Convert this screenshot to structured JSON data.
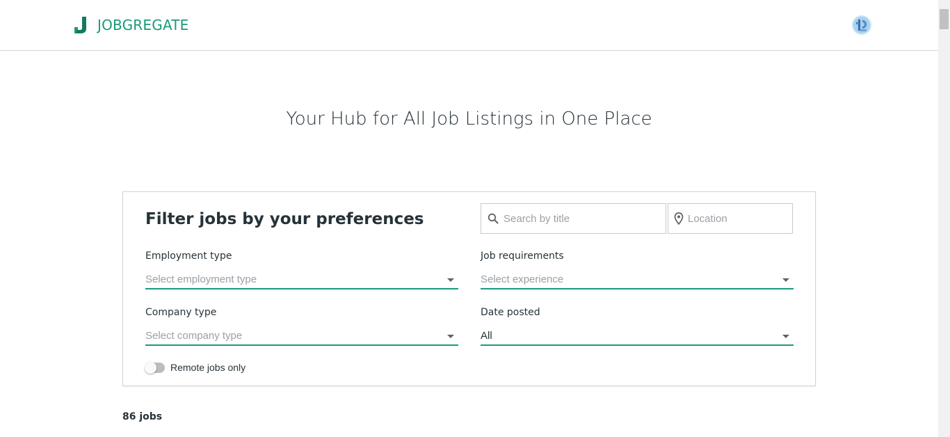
{
  "brand": {
    "name": "JOBGREGATE",
    "logo_icon": "j-logo-icon",
    "color": "#1a9a7a"
  },
  "header": {
    "avatar_icon": "user-avatar"
  },
  "hero": {
    "title": "Your Hub for All Job Listings in One Place"
  },
  "filters": {
    "title": "Filter jobs by your preferences",
    "search": {
      "placeholder": "Search by title",
      "value": "",
      "icon": "search-icon"
    },
    "location": {
      "placeholder": "Location",
      "value": "",
      "icon": "location-pin-icon"
    },
    "employment_type": {
      "label": "Employment type",
      "value": "Select employment type"
    },
    "job_requirements": {
      "label": "Job requirements",
      "value": "Select experience"
    },
    "company_type": {
      "label": "Company type",
      "value": "Select company type"
    },
    "date_posted": {
      "label": "Date posted",
      "value": "All"
    },
    "remote": {
      "label": "Remote jobs only",
      "enabled": false
    }
  },
  "results": {
    "count_text": "86 jobs"
  },
  "colors": {
    "accent": "#1a9a7a",
    "text": "#263238",
    "placeholder": "#9aa0a6"
  }
}
